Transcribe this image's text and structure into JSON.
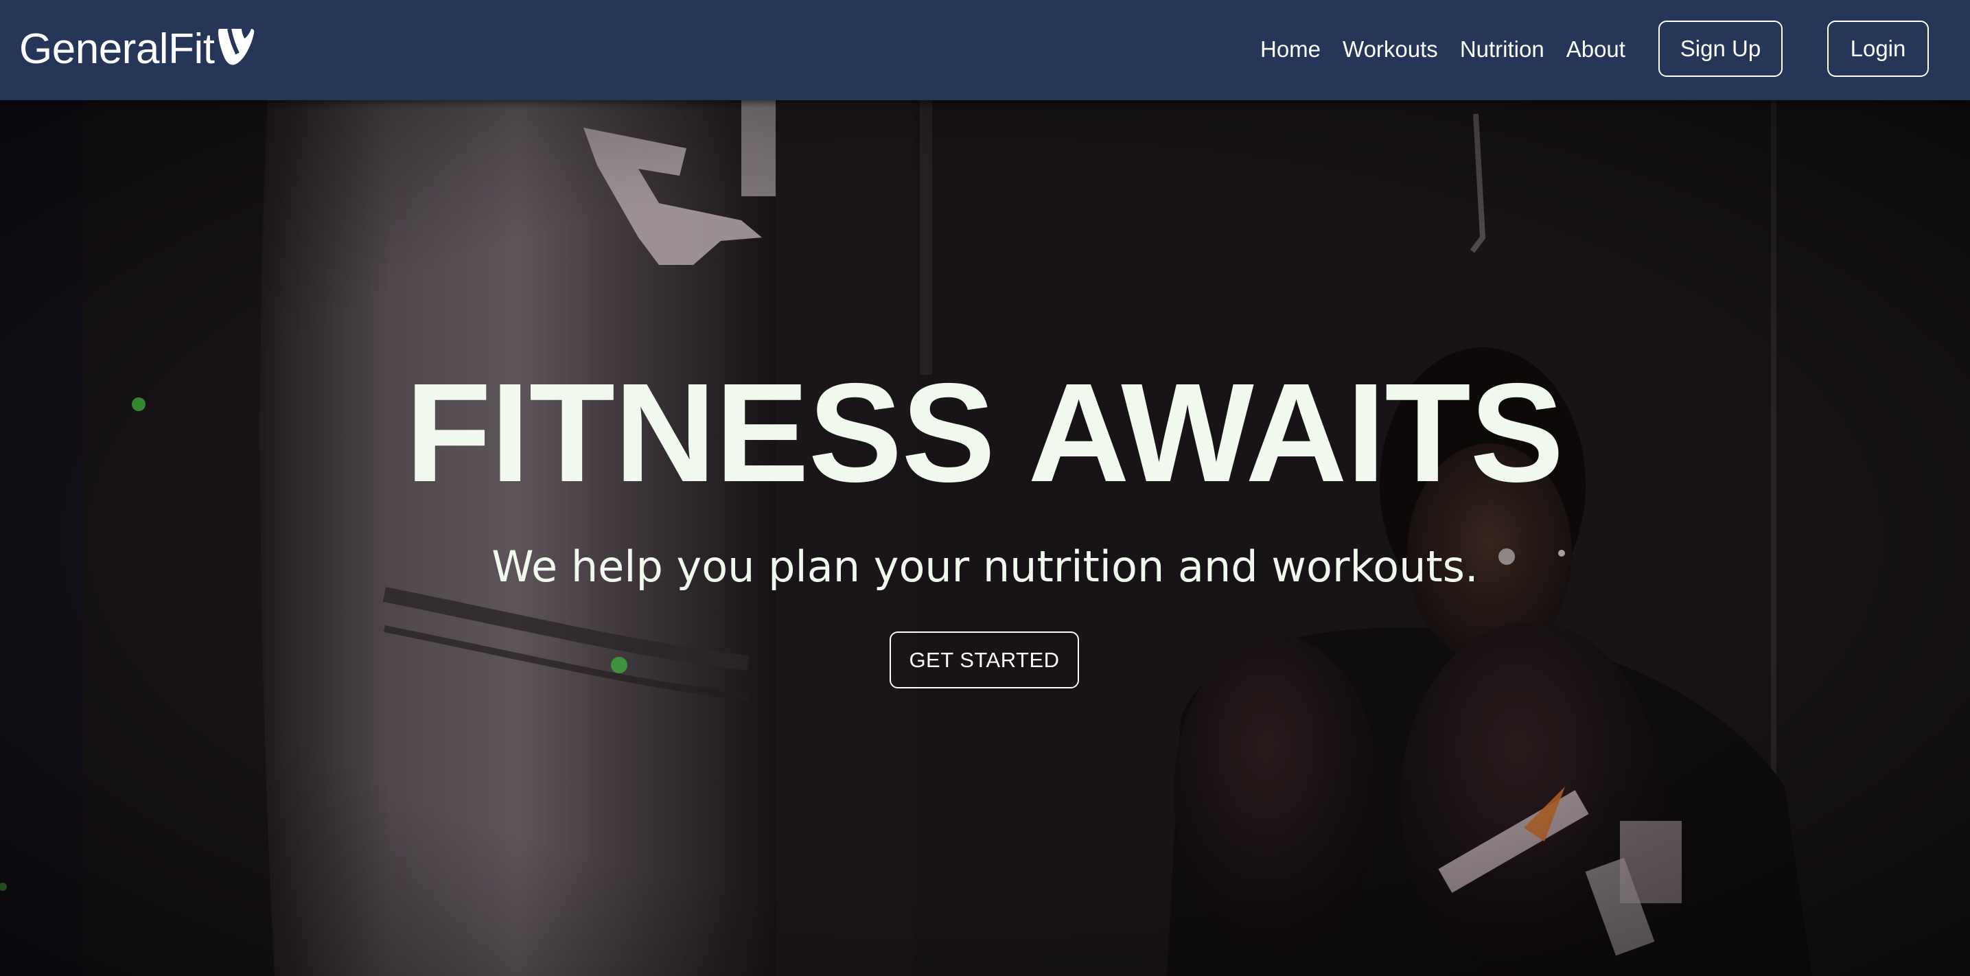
{
  "brand": {
    "name": "GeneralFit",
    "logo_icon": "typo3-logo-icon"
  },
  "nav": {
    "links": [
      {
        "label": "Home"
      },
      {
        "label": "Workouts"
      },
      {
        "label": "Nutrition"
      },
      {
        "label": "About"
      }
    ],
    "signup_label": "Sign Up",
    "login_label": "Login"
  },
  "hero": {
    "title": "FITNESS AWAITS",
    "subtitle": "We help you plan your nutrition and workouts.",
    "cta_label": "GET STARTED",
    "background": "boxer-with-punching-bag-photo"
  },
  "colors": {
    "navbar_bg": "#253658",
    "hero_text": "#f1f9ef",
    "button_border": "#ffffff"
  }
}
